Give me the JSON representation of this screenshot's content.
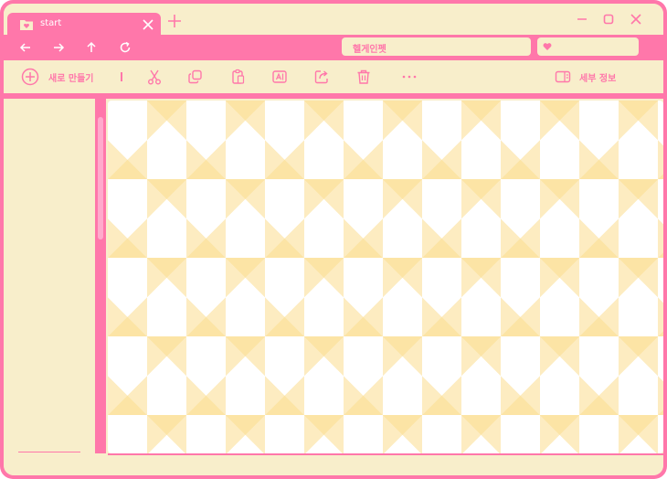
{
  "window": {
    "colors": {
      "frame": "#ff77aa",
      "panel": "#f8eecb",
      "pattern": "#fbdd8e"
    }
  },
  "tab": {
    "title": "start",
    "icon": "folder-heart-icon"
  },
  "addressbar": {
    "path": "헬게인펫",
    "search_placeholder": ""
  },
  "toolbar": {
    "new_label": "새로 만들기",
    "details_label": "세부 정보",
    "icons": [
      "cut-icon",
      "copy-icon",
      "paste-icon",
      "rename-icon",
      "share-icon",
      "delete-icon",
      "more-icon"
    ]
  }
}
